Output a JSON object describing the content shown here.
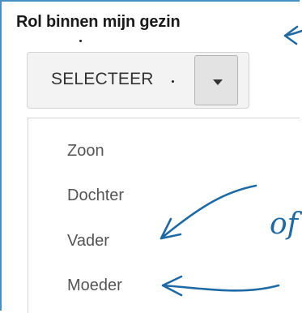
{
  "field": {
    "label": "Rol binnen mijn gezin"
  },
  "select": {
    "value": "SELECTEER",
    "toggle_icon": "chevron-down-icon"
  },
  "dropdown": {
    "options": [
      {
        "label": "Zoon"
      },
      {
        "label": "Dochter"
      },
      {
        "label": "Vader"
      },
      {
        "label": "Moeder"
      }
    ]
  },
  "annotation": {
    "text": "of",
    "color": "#1f6aa5"
  },
  "colors": {
    "frame_border": "#4a8fc2",
    "arrow": "#1f6aa5"
  }
}
